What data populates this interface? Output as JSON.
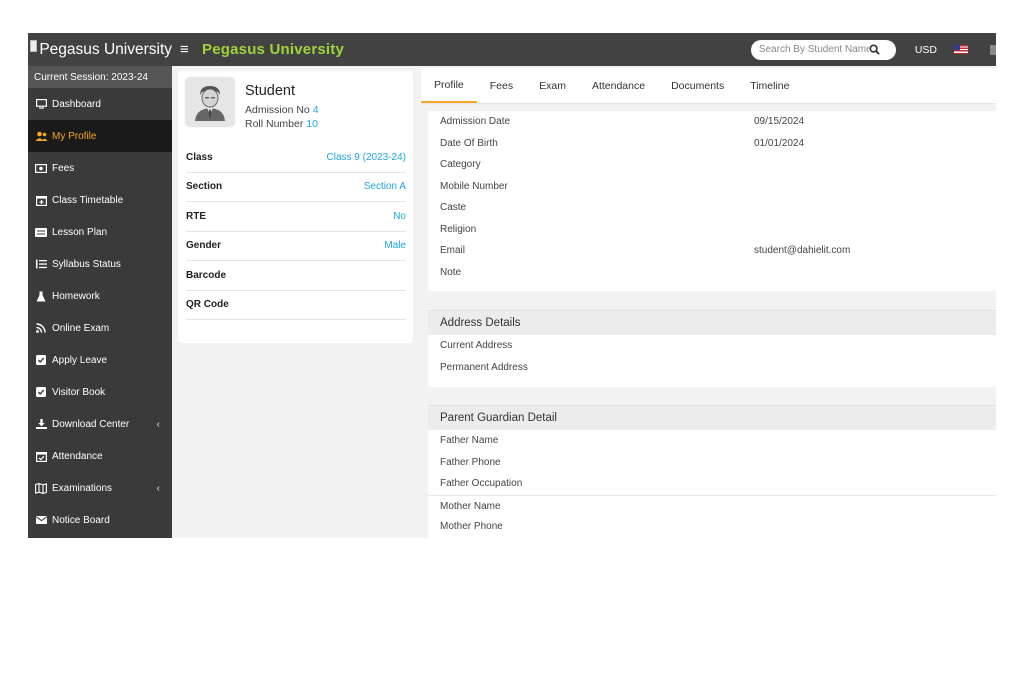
{
  "topbar": {
    "school_name": "Pegasus University",
    "brand": "Pegasus University",
    "search_placeholder": "Search By Student Name",
    "currency": "USD",
    "menu_icon": "hamburger-icon",
    "brand_color": "#9fd43b"
  },
  "sidebar": {
    "session": "Current Session: 2023-24",
    "items": [
      {
        "label": "Dashboard",
        "icon": "monitor-icon"
      },
      {
        "label": "My Profile",
        "icon": "user-group-icon"
      },
      {
        "label": "Fees",
        "icon": "money-icon"
      },
      {
        "label": "Class Timetable",
        "icon": "calendar-plus-icon"
      },
      {
        "label": "Lesson Plan",
        "icon": "list-alt-icon"
      },
      {
        "label": "Syllabus Status",
        "icon": "list-ol-icon"
      },
      {
        "label": "Homework",
        "icon": "flask-icon"
      },
      {
        "label": "Online Exam",
        "icon": "rss-icon"
      },
      {
        "label": "Apply Leave",
        "icon": "check-square-icon"
      },
      {
        "label": "Visitor Book",
        "icon": "check-square-icon"
      },
      {
        "label": "Download Center",
        "icon": "download-icon"
      },
      {
        "label": "Attendance",
        "icon": "calendar-check-icon"
      },
      {
        "label": "Examinations",
        "icon": "map-icon"
      },
      {
        "label": "Notice Board",
        "icon": "envelope-icon"
      }
    ],
    "active_color": "#f5a623"
  },
  "profile": {
    "name": "Student",
    "admission_label": "Admission No",
    "admission_no": "4",
    "roll_label": "Roll Number",
    "roll_no": "10",
    "info": [
      {
        "label": "Class",
        "value": "Class 9 (2023-24)"
      },
      {
        "label": "Section",
        "value": "Section A"
      },
      {
        "label": "RTE",
        "value": "No"
      },
      {
        "label": "Gender",
        "value": "Male"
      },
      {
        "label": "Barcode",
        "value": ""
      },
      {
        "label": "QR Code",
        "value": ""
      }
    ],
    "link_color": "#1ea4e0"
  },
  "tabs": [
    "Profile",
    "Fees",
    "Exam",
    "Attendance",
    "Documents",
    "Timeline"
  ],
  "details": [
    {
      "label": "Admission Date",
      "value": "09/15/2024"
    },
    {
      "label": "Date Of Birth",
      "value": "01/01/2024"
    },
    {
      "label": "Category",
      "value": ""
    },
    {
      "label": "Mobile Number",
      "value": ""
    },
    {
      "label": "Caste",
      "value": ""
    },
    {
      "label": "Religion",
      "value": ""
    },
    {
      "label": "Email",
      "value": "student@dahielit.com"
    },
    {
      "label": "Note",
      "value": ""
    }
  ],
  "address": {
    "title": "Address Details",
    "rows": [
      {
        "label": "Current Address",
        "value": ""
      },
      {
        "label": "Permanent Address",
        "value": ""
      }
    ]
  },
  "guardian": {
    "title": "Parent Guardian Detail",
    "rows": [
      {
        "label": "Father Name",
        "value": ""
      },
      {
        "label": "Father Phone",
        "value": ""
      },
      {
        "label": "Father Occupation",
        "value": ""
      },
      {
        "label": "Mother Name",
        "value": ""
      },
      {
        "label": "Mother Phone",
        "value": ""
      }
    ]
  }
}
